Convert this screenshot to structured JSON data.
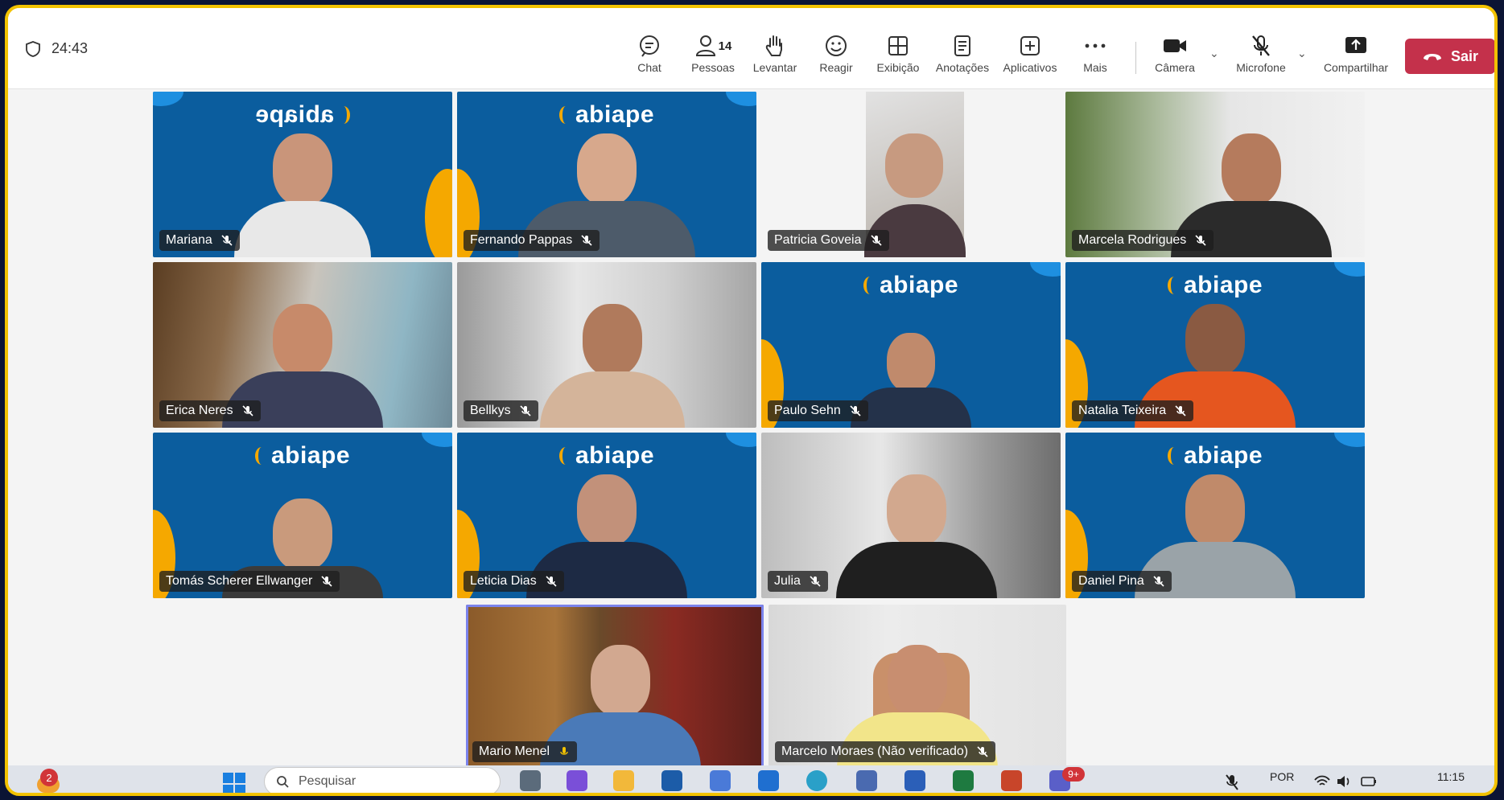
{
  "meeting": {
    "timer": "24:43",
    "toolbar": {
      "chat": "Chat",
      "people": "Pessoas",
      "people_count": "14",
      "raise": "Levantar",
      "react": "Reagir",
      "view": "Exibição",
      "notes": "Anotações",
      "apps": "Aplicativos",
      "more": "Mais",
      "camera": "Câmera",
      "mic": "Microfone",
      "share": "Compartilhar",
      "leave": "Sair"
    },
    "brand_logo": "abiape",
    "participants": [
      {
        "name": "Mariana"
      },
      {
        "name": "Fernando Pappas"
      },
      {
        "name": "Patricia Goveia"
      },
      {
        "name": "Marcela Rodrigues"
      },
      {
        "name": "Erica Neres"
      },
      {
        "name": "Bellkys"
      },
      {
        "name": "Paulo Sehn"
      },
      {
        "name": "Natalia Teixeira"
      },
      {
        "name": "Tomás Scherer Ellwanger"
      },
      {
        "name": "Leticia Dias"
      },
      {
        "name": "Julia"
      },
      {
        "name": "Daniel Pina"
      },
      {
        "name": "Mario Menel"
      },
      {
        "name": "Marcelo Moraes (Não verificado)"
      }
    ]
  },
  "taskbar": {
    "notifications": "2",
    "search_placeholder": "Pesquisar",
    "teams_badge": "9+",
    "language": "POR",
    "time": "11:15"
  },
  "colors": {
    "frame": "#f2c200",
    "brand_blue": "#0b5d9e",
    "brand_orange": "#f5a800",
    "leave_red": "#c4314b"
  }
}
